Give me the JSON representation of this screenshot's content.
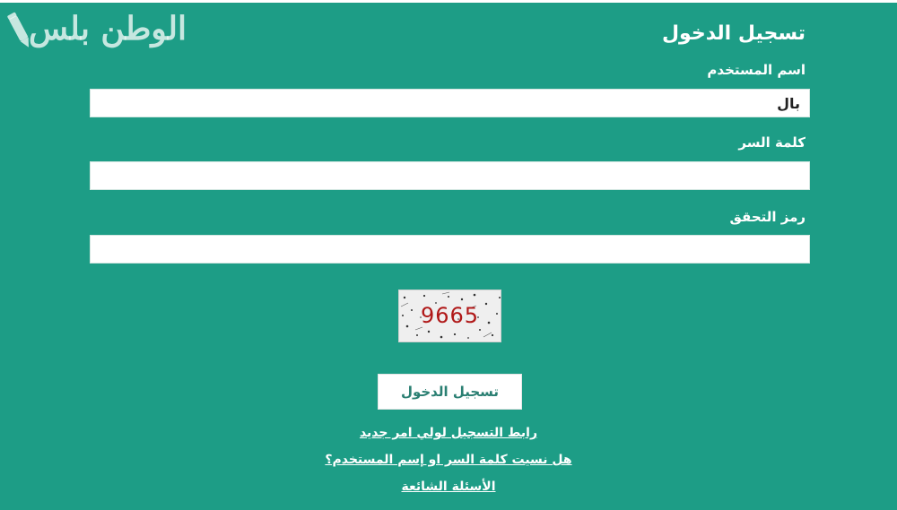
{
  "logo": {
    "text": "الوطن بلس",
    "icon": "pencil-icon"
  },
  "form": {
    "title": "تسجيل الدخول",
    "username": {
      "label": "اسم المستخدم",
      "value": "بال"
    },
    "password": {
      "label": "كلمة السر",
      "value": ""
    },
    "verification": {
      "label": "رمز التحقق",
      "value": ""
    },
    "captcha": {
      "code": "9665"
    },
    "submit_label": "تسجيل الدخول"
  },
  "links": {
    "register": "رابط التسجيل لولي امر جديد",
    "forgot": "هل نسيت كلمة السر او إسم المستخدم؟",
    "faq": "الأسئلة الشائعة"
  },
  "colors": {
    "background": "#1d9d86",
    "captcha_text": "#b01818",
    "button_text": "#2a7f72"
  }
}
